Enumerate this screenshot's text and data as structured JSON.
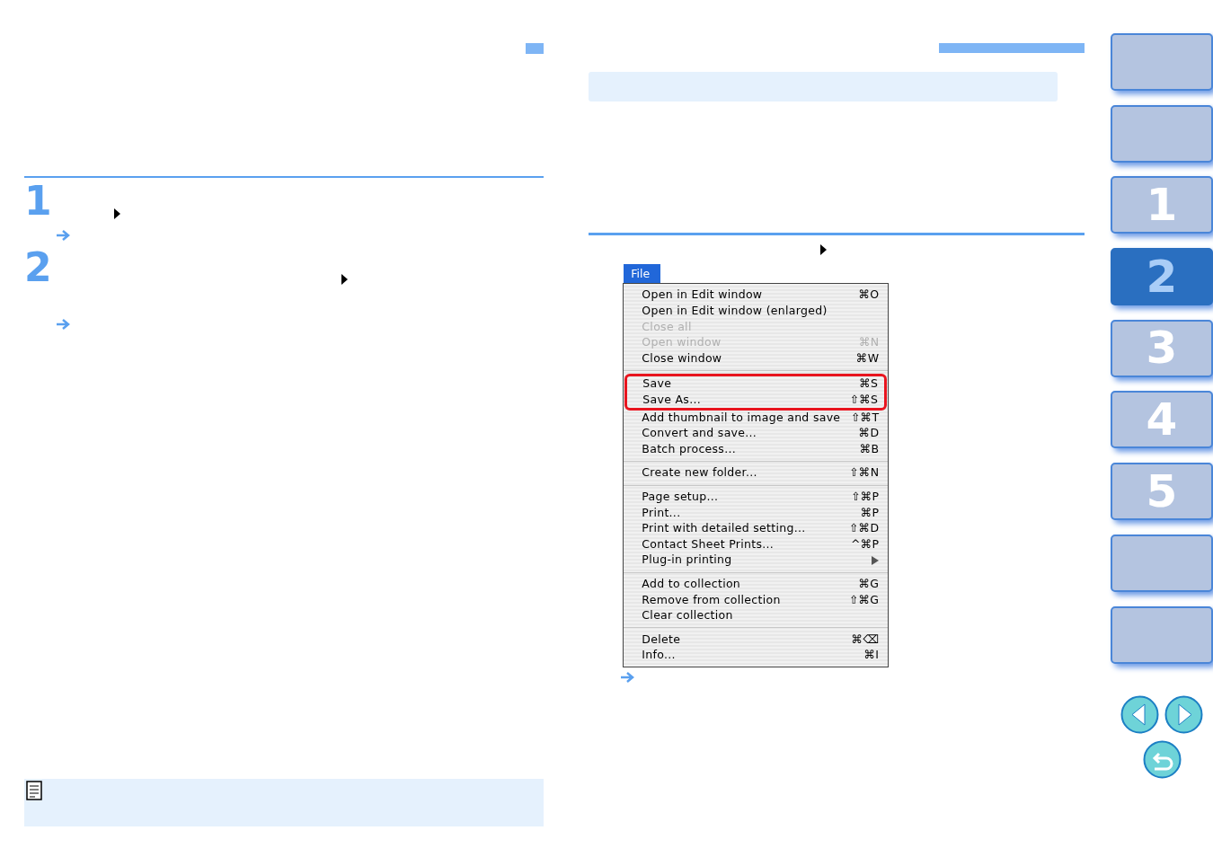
{
  "steps": [
    {
      "number": "1"
    },
    {
      "number": "2"
    }
  ],
  "menu": {
    "title": "File",
    "groups": [
      {
        "items": [
          {
            "label": "Open in Edit window",
            "shortcut": "⌘O",
            "disabled": false,
            "highlighted": false
          },
          {
            "label": "Open in Edit window (enlarged)",
            "disabled": false,
            "highlighted": false
          },
          {
            "label": "Close all",
            "disabled": true,
            "highlighted": false
          },
          {
            "label": "Open window",
            "shortcut": "⌘N",
            "disabled": true,
            "highlighted": false
          },
          {
            "label": "Close window",
            "shortcut": "⌘W",
            "disabled": false,
            "highlighted": false
          }
        ]
      },
      {
        "items": [
          {
            "label": "Save",
            "shortcut": "⌘S",
            "disabled": false,
            "highlighted": true
          },
          {
            "label": "Save As...",
            "shortcut": "⇧⌘S",
            "disabled": false,
            "highlighted": true
          },
          {
            "label": "Add thumbnail to image and save",
            "shortcut": "⇧⌘T",
            "disabled": false,
            "highlighted": false
          },
          {
            "label": "Convert and save...",
            "shortcut": "⌘D",
            "disabled": false,
            "highlighted": false
          },
          {
            "label": "Batch process...",
            "shortcut": "⌘B",
            "disabled": false,
            "highlighted": false
          }
        ]
      },
      {
        "items": [
          {
            "label": "Create new folder...",
            "shortcut": "⇧⌘N",
            "disabled": false,
            "highlighted": false
          }
        ]
      },
      {
        "items": [
          {
            "label": "Page setup...",
            "shortcut": "⇧⌘P",
            "disabled": false,
            "highlighted": false
          },
          {
            "label": "Print...",
            "shortcut": "⌘P",
            "disabled": false,
            "highlighted": false
          },
          {
            "label": "Print with detailed setting...",
            "shortcut": "⇧⌘D",
            "disabled": false,
            "highlighted": false
          },
          {
            "label": "Contact Sheet Prints...",
            "shortcut": "^⌘P",
            "disabled": false,
            "highlighted": false
          },
          {
            "label": "Plug-in printing",
            "submenu": true,
            "disabled": false,
            "highlighted": false
          }
        ]
      },
      {
        "items": [
          {
            "label": "Add to collection",
            "shortcut": "⌘G",
            "disabled": false,
            "highlighted": false
          },
          {
            "label": "Remove from collection",
            "shortcut": "⇧⌘G",
            "disabled": false,
            "highlighted": false
          },
          {
            "label": "Clear collection",
            "disabled": false,
            "highlighted": false
          }
        ]
      },
      {
        "items": [
          {
            "label": "Delete",
            "shortcut": "⌘⌫",
            "disabled": false,
            "highlighted": false
          },
          {
            "label": "Info...",
            "shortcut": "⌘I",
            "disabled": false,
            "highlighted": false
          }
        ]
      }
    ]
  },
  "sidebar": {
    "tabs": [
      {
        "selected": false
      },
      {
        "selected": false
      },
      {
        "label": "1",
        "selected": false
      },
      {
        "label": "2",
        "selected": true
      },
      {
        "label": "3",
        "selected": false
      },
      {
        "label": "4",
        "selected": false
      },
      {
        "label": "5",
        "selected": false
      },
      {
        "selected": false
      },
      {
        "selected": false
      }
    ]
  }
}
